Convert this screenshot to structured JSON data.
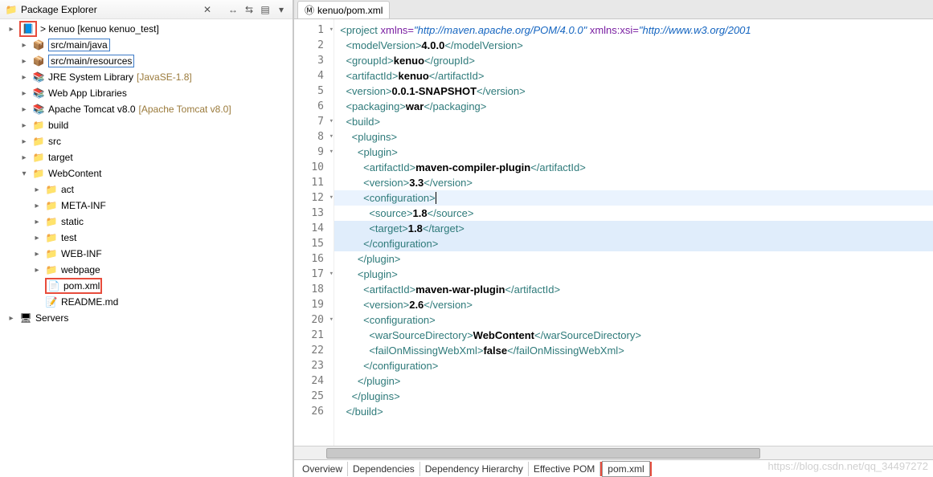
{
  "sidebar": {
    "title": "Package Explorer",
    "close": "✕",
    "toolbar": [
      "↔",
      "⇆",
      "▤",
      "▾"
    ],
    "tree": [
      {
        "lvl": 0,
        "caret": "▸",
        "icon": "proj",
        "text": "> kenuo [kenuo kenuo_test]",
        "boxRed": true
      },
      {
        "lvl": 1,
        "caret": "▸",
        "icon": "pkg",
        "text": "src/main/java",
        "boxBlue": true
      },
      {
        "lvl": 1,
        "caret": "▸",
        "icon": "pkg",
        "text": "src/main/resources",
        "boxBlue": true
      },
      {
        "lvl": 1,
        "caret": "▸",
        "icon": "lib",
        "text": "JRE System Library ",
        "suffix": "[JavaSE-1.8]"
      },
      {
        "lvl": 1,
        "caret": "▸",
        "icon": "lib",
        "text": "Web App Libraries"
      },
      {
        "lvl": 1,
        "caret": "▸",
        "icon": "lib",
        "text": "Apache Tomcat v8.0 ",
        "suffix": "[Apache Tomcat v8.0]"
      },
      {
        "lvl": 1,
        "caret": "▸",
        "icon": "fld",
        "text": "build"
      },
      {
        "lvl": 1,
        "caret": "▸",
        "icon": "fld",
        "text": "src"
      },
      {
        "lvl": 1,
        "caret": "▸",
        "icon": "fld",
        "text": "target"
      },
      {
        "lvl": 1,
        "caret": "▾",
        "icon": "fld",
        "text": "WebContent"
      },
      {
        "lvl": 2,
        "caret": "▸",
        "icon": "fld",
        "text": "act"
      },
      {
        "lvl": 2,
        "caret": "▸",
        "icon": "fld",
        "text": "META-INF"
      },
      {
        "lvl": 2,
        "caret": "▸",
        "icon": "fld",
        "text": "static"
      },
      {
        "lvl": 2,
        "caret": "▸",
        "icon": "fld",
        "text": "test"
      },
      {
        "lvl": 2,
        "caret": "▸",
        "icon": "fld",
        "text": "WEB-INF"
      },
      {
        "lvl": 2,
        "caret": "▸",
        "icon": "fld",
        "text": "webpage"
      },
      {
        "lvl": 2,
        "caret": "",
        "icon": "xml",
        "text": "pom.xml",
        "boxFile": true
      },
      {
        "lvl": 2,
        "caret": "",
        "icon": "md",
        "text": "README.md"
      },
      {
        "lvl": 0,
        "caret": "▸",
        "icon": "srv",
        "text": "Servers"
      }
    ]
  },
  "editor": {
    "tabTitle": "kenuo/pom.xml",
    "bottomTabs": [
      "Overview",
      "Dependencies",
      "Dependency Hierarchy",
      "Effective POM",
      "pom.xml"
    ],
    "lines": [
      {
        "n": 1,
        "fold": true,
        "hl": false,
        "segs": [
          [
            "  ",
            ""
          ],
          [
            "<project",
            "tag"
          ],
          [
            " ",
            ""
          ],
          [
            "xmlns=",
            "attr"
          ],
          [
            "\"http://maven.apache.org/POM/4.0.0\"",
            "str"
          ],
          [
            " ",
            ""
          ],
          [
            "xmlns:xsi=",
            "attr"
          ],
          [
            "\"http://www.w3.org/2001",
            "str"
          ]
        ]
      },
      {
        "n": 2,
        "segs": [
          [
            "    ",
            ""
          ],
          [
            "<modelVersion>",
            "tag"
          ],
          [
            "4.0.0",
            "text"
          ],
          [
            "</modelVersion>",
            "tag"
          ]
        ]
      },
      {
        "n": 3,
        "segs": [
          [
            "    ",
            ""
          ],
          [
            "<groupId>",
            "tag"
          ],
          [
            "kenuo",
            "text"
          ],
          [
            "</groupId>",
            "tag"
          ]
        ]
      },
      {
        "n": 4,
        "segs": [
          [
            "    ",
            ""
          ],
          [
            "<artifactId>",
            "tag"
          ],
          [
            "kenuo",
            "text"
          ],
          [
            "</artifactId>",
            "tag"
          ]
        ]
      },
      {
        "n": 5,
        "segs": [
          [
            "    ",
            ""
          ],
          [
            "<version>",
            "tag"
          ],
          [
            "0.0.1-SNAPSHOT",
            "text"
          ],
          [
            "</version>",
            "tag"
          ]
        ]
      },
      {
        "n": 6,
        "segs": [
          [
            "    ",
            ""
          ],
          [
            "<packaging>",
            "tag"
          ],
          [
            "war",
            "text"
          ],
          [
            "</packaging>",
            "tag"
          ]
        ]
      },
      {
        "n": 7,
        "fold": true,
        "segs": [
          [
            "    ",
            ""
          ],
          [
            "<build>",
            "tag"
          ]
        ]
      },
      {
        "n": 8,
        "fold": true,
        "segs": [
          [
            "      ",
            ""
          ],
          [
            "<plugins>",
            "tag"
          ]
        ]
      },
      {
        "n": 9,
        "fold": true,
        "segs": [
          [
            "        ",
            ""
          ],
          [
            "<plugin>",
            "tag"
          ]
        ]
      },
      {
        "n": 10,
        "segs": [
          [
            "          ",
            ""
          ],
          [
            "<artifactId>",
            "tag"
          ],
          [
            "maven-compiler-plugin",
            "text"
          ],
          [
            "</artifactId>",
            "tag"
          ]
        ]
      },
      {
        "n": 11,
        "segs": [
          [
            "          ",
            ""
          ],
          [
            "<version>",
            "tag"
          ],
          [
            "3.3",
            "text"
          ],
          [
            "</version>",
            "tag"
          ]
        ]
      },
      {
        "n": 12,
        "fold": true,
        "hl": true,
        "segs": [
          [
            "          ",
            ""
          ],
          [
            "<configuration>",
            "tag"
          ]
        ],
        "cursor": true
      },
      {
        "n": 13,
        "segs": [
          [
            "            ",
            ""
          ],
          [
            "<source>",
            "tag"
          ],
          [
            "1.8",
            "text"
          ],
          [
            "</source>",
            "tag"
          ]
        ]
      },
      {
        "n": 14,
        "strip": true,
        "segs": [
          [
            "            ",
            ""
          ],
          [
            "<target>",
            "tag"
          ],
          [
            "1.8",
            "text"
          ],
          [
            "</target>",
            "tag"
          ]
        ]
      },
      {
        "n": 15,
        "strip": true,
        "segs": [
          [
            "          ",
            ""
          ],
          [
            "</configuration>",
            "tag"
          ]
        ]
      },
      {
        "n": 16,
        "segs": [
          [
            "        ",
            ""
          ],
          [
            "</plugin>",
            "tag"
          ]
        ]
      },
      {
        "n": 17,
        "fold": true,
        "segs": [
          [
            "        ",
            ""
          ],
          [
            "<plugin>",
            "tag"
          ]
        ]
      },
      {
        "n": 18,
        "segs": [
          [
            "          ",
            ""
          ],
          [
            "<artifactId>",
            "tag"
          ],
          [
            "maven-war-plugin",
            "text"
          ],
          [
            "</artifactId>",
            "tag"
          ]
        ]
      },
      {
        "n": 19,
        "segs": [
          [
            "          ",
            ""
          ],
          [
            "<version>",
            "tag"
          ],
          [
            "2.6",
            "text"
          ],
          [
            "</version>",
            "tag"
          ]
        ]
      },
      {
        "n": 20,
        "fold": true,
        "segs": [
          [
            "          ",
            ""
          ],
          [
            "<configuration>",
            "tag"
          ]
        ]
      },
      {
        "n": 21,
        "segs": [
          [
            "            ",
            ""
          ],
          [
            "<warSourceDirectory>",
            "tag"
          ],
          [
            "WebContent",
            "text"
          ],
          [
            "</warSourceDirectory>",
            "tag"
          ]
        ]
      },
      {
        "n": 22,
        "segs": [
          [
            "            ",
            ""
          ],
          [
            "<failOnMissingWebXml>",
            "tag"
          ],
          [
            "false",
            "text"
          ],
          [
            "</failOnMissingWebXml>",
            "tag"
          ]
        ]
      },
      {
        "n": 23,
        "segs": [
          [
            "          ",
            ""
          ],
          [
            "</configuration>",
            "tag"
          ]
        ]
      },
      {
        "n": 24,
        "segs": [
          [
            "        ",
            ""
          ],
          [
            "</plugin>",
            "tag"
          ]
        ]
      },
      {
        "n": 25,
        "segs": [
          [
            "      ",
            ""
          ],
          [
            "</plugins>",
            "tag"
          ]
        ]
      },
      {
        "n": 26,
        "segs": [
          [
            "    ",
            ""
          ],
          [
            "</build>",
            "tag"
          ]
        ]
      }
    ]
  },
  "watermark": "https://blog.csdn.net/qq_34497272"
}
